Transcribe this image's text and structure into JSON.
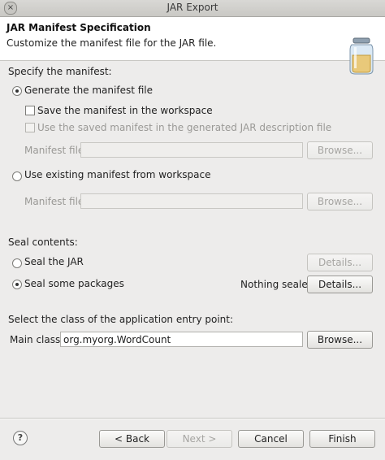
{
  "window": {
    "title": "JAR Export",
    "close_glyph": "×"
  },
  "header": {
    "title": "JAR Manifest Specification",
    "description": "Customize the manifest file for the JAR file.",
    "icon": "jar-icon"
  },
  "manifest": {
    "section_label": "Specify the manifest:",
    "generate_option": "Generate the manifest file",
    "save_in_workspace": "Save the manifest in the workspace",
    "use_saved": "Use the saved manifest in the generated JAR description file",
    "manifest_file_label": "Manifest file:",
    "manifest_file_value": "",
    "browse": "Browse...",
    "use_existing_option": "Use existing manifest from workspace",
    "existing_file_label": "Manifest file:",
    "existing_file_value": "",
    "browse2": "Browse..."
  },
  "seal": {
    "section_label": "Seal contents:",
    "seal_jar": "Seal the JAR",
    "seal_jar_details": "Details...",
    "seal_packages": "Seal some packages",
    "status": "Nothing sealed",
    "seal_packages_details": "Details..."
  },
  "entry": {
    "section_label": "Select the class of the application entry point:",
    "main_class_label": "Main class:",
    "main_class_value": "org.myorg.WordCount",
    "browse": "Browse..."
  },
  "footer": {
    "help_glyph": "?",
    "back": "< Back",
    "next": "Next >",
    "cancel": "Cancel",
    "finish": "Finish"
  }
}
